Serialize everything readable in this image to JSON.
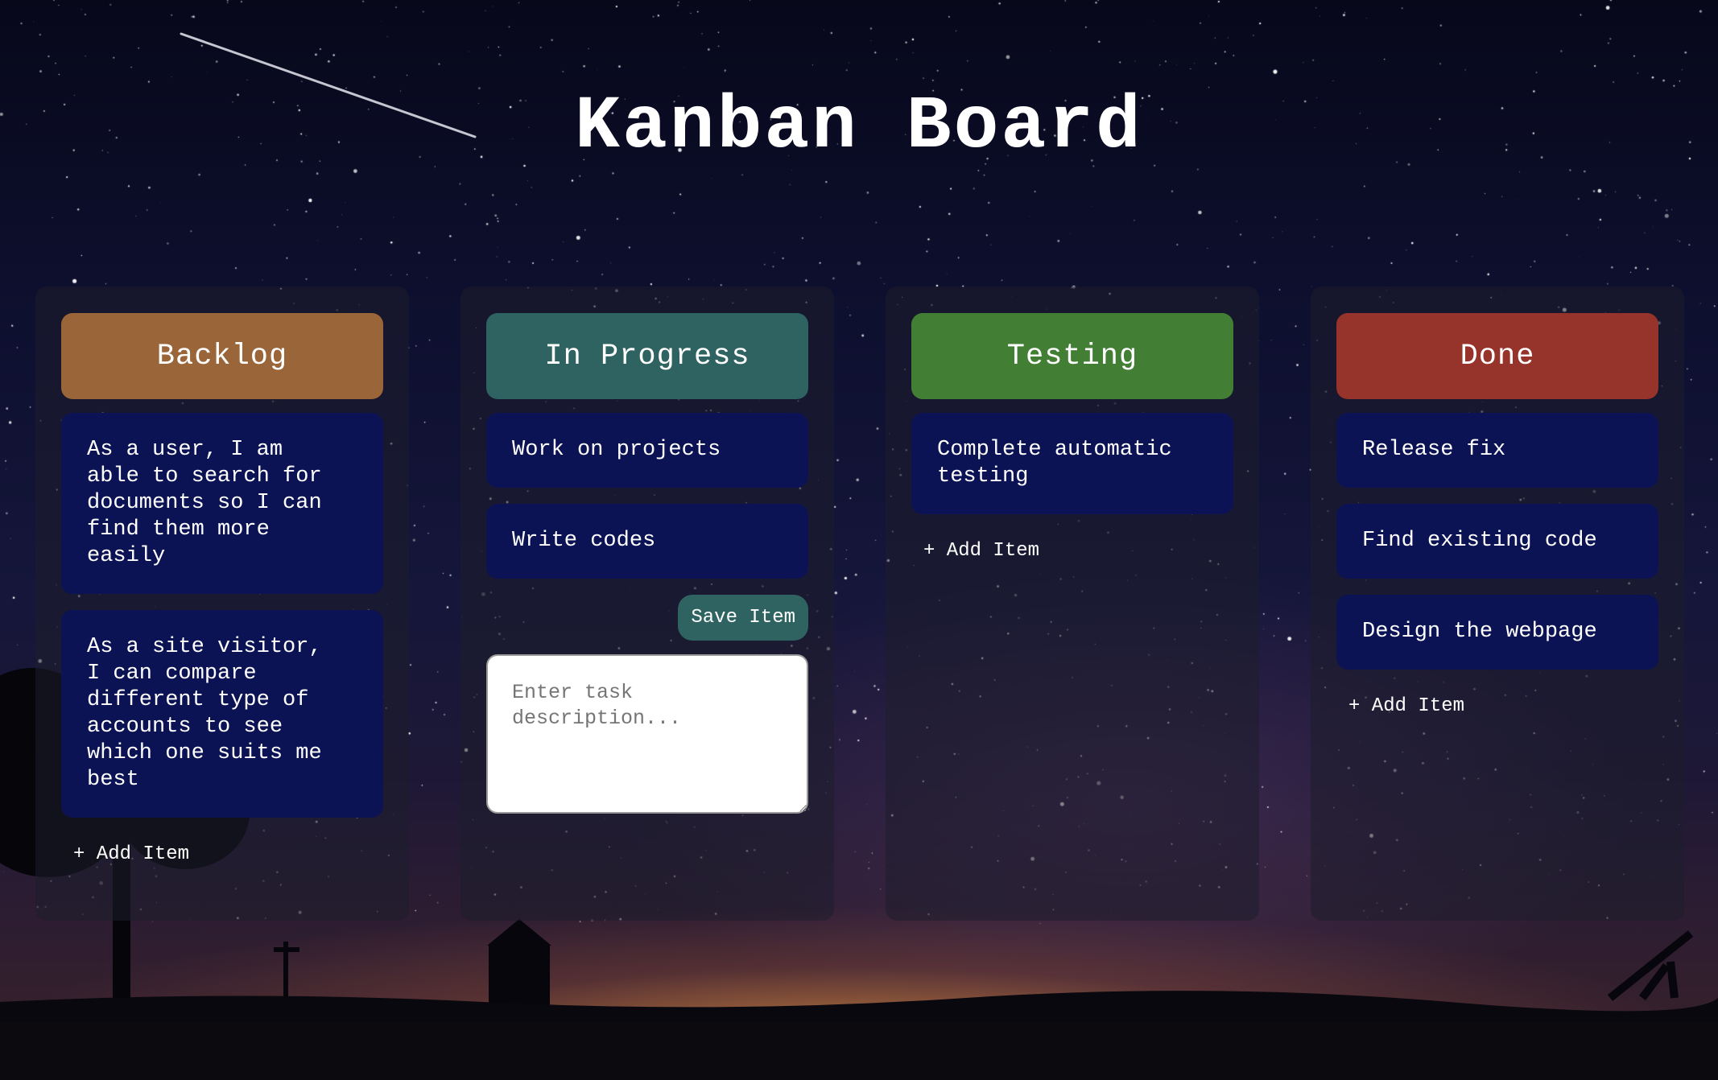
{
  "title": "Kanban Board",
  "colors": {
    "backlog": "#9b653a",
    "in_progress": "#2f6361",
    "testing": "#427f35",
    "done": "#96332a",
    "item_bg": "#0b1354"
  },
  "columns": [
    {
      "name": "Backlog",
      "items": [
        "As a user, I am\nable to search for\ndocuments so I can\nfind them more\neasily",
        "As a site visitor,\nI can compare\ndifferent type of\naccounts to see\nwhich one suits me\nbest"
      ],
      "add_label": "+ Add Item"
    },
    {
      "name": "In Progress",
      "items": [
        "Work on projects",
        "Write codes"
      ],
      "save_label": "Save Item",
      "input_placeholder": "Enter task description..."
    },
    {
      "name": "Testing",
      "items": [
        "Complete automatic\ntesting"
      ],
      "add_label": "+ Add Item"
    },
    {
      "name": "Done",
      "items": [
        "Release fix",
        "Find existing code",
        "Design the webpage"
      ],
      "add_label": "+ Add Item"
    }
  ]
}
